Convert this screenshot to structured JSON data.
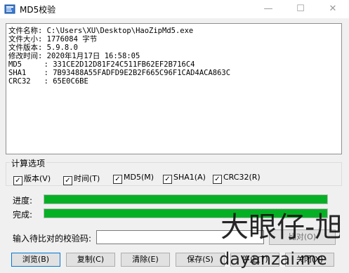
{
  "window": {
    "title": "MD5校验",
    "controls": {
      "minimize": "—",
      "maximize": "☐",
      "close": "✕"
    }
  },
  "info": {
    "lines": [
      "文件名称: C:\\Users\\XU\\Desktop\\HaoZipMd5.exe",
      "文件大小: 1776084 字节",
      "文件版本: 5.9.8.0",
      "修改时间: 2020年1月17日 16:58:05",
      "MD5     : 331CE2D12D81F24C511FB62EF2B716C4",
      "SHA1    : 7B93488A55FADFD9E2B2F665C96F1CAD4ACA863C",
      "CRC32   : 65E0C6BE"
    ]
  },
  "options": {
    "legend": "计算选项",
    "items": [
      {
        "label": "版本(V)",
        "checked": true
      },
      {
        "label": "时间(T)",
        "checked": true
      },
      {
        "label": "MD5(M)",
        "checked": true
      },
      {
        "label": "SHA1(A)",
        "checked": true
      },
      {
        "label": "CRC32(R)",
        "checked": true
      }
    ]
  },
  "progress": {
    "label": "进度:",
    "value": 1.0
  },
  "complete": {
    "label": "完成:",
    "value": 1.0
  },
  "compare": {
    "label": "输入待比对的校验码:",
    "value": "",
    "button": "比对(O)"
  },
  "buttons": {
    "browse": "浏览(B)",
    "copy": "复制(C)",
    "clear": "清除(E)",
    "save": "保存(S)",
    "stop": "停止(T)",
    "close": "关闭(X)"
  },
  "colors": {
    "progress_fill": "#06b025",
    "focus_border": "#0078d7"
  },
  "watermark": {
    "top": "大眼仔-旭",
    "bottom": "dayanzai.me"
  }
}
